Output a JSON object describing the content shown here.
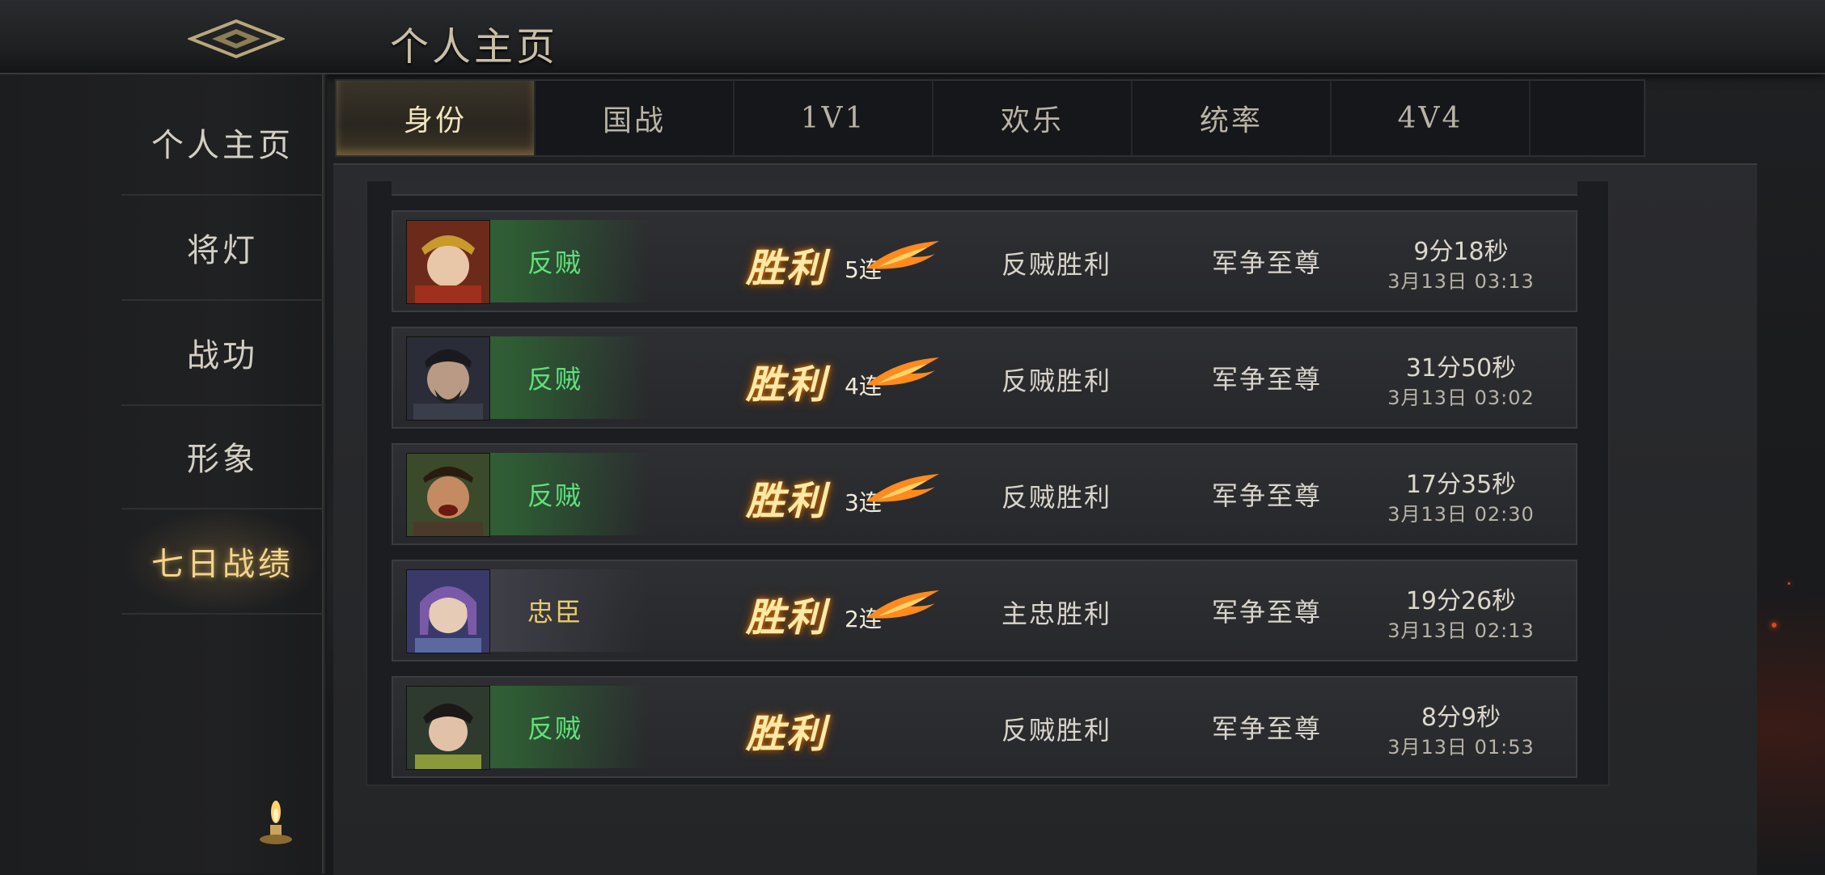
{
  "header": {
    "title": "个人主页",
    "back_icon": "ornate-diamond-back-icon"
  },
  "sidebar": {
    "items": [
      {
        "label": "个人主页",
        "active": false
      },
      {
        "label": "将灯",
        "active": false
      },
      {
        "label": "战功",
        "active": false
      },
      {
        "label": "形象",
        "active": false
      },
      {
        "label": "七日战绩",
        "active": true
      }
    ],
    "decor_icon": "candle-icon"
  },
  "tabs": [
    {
      "label": "身份",
      "active": true
    },
    {
      "label": "国战",
      "active": false
    },
    {
      "label": "1V1",
      "active": false
    },
    {
      "label": "欢乐",
      "active": false
    },
    {
      "label": "统率",
      "active": false
    },
    {
      "label": "4V4",
      "active": false
    }
  ],
  "records": [
    {
      "role": "反贼",
      "role_type": "rebel",
      "outcome": "胜利",
      "streak_num": "5",
      "streak_suffix": "连",
      "result": "反贼胜利",
      "mode": "军争至尊",
      "duration": "9分18秒",
      "datetime": "3月13日 03:13",
      "avatar_icon": "female-general-avatar-icon"
    },
    {
      "role": "反贼",
      "role_type": "rebel",
      "outcome": "胜利",
      "streak_num": "4",
      "streak_suffix": "连",
      "result": "反贼胜利",
      "mode": "军争至尊",
      "duration": "31分50秒",
      "datetime": "3月13日 03:02",
      "avatar_icon": "bearded-general-avatar-icon"
    },
    {
      "role": "反贼",
      "role_type": "rebel",
      "outcome": "胜利",
      "streak_num": "3",
      "streak_suffix": "连",
      "result": "反贼胜利",
      "mode": "军争至尊",
      "duration": "17分35秒",
      "datetime": "3月13日 02:30",
      "avatar_icon": "shouting-general-avatar-icon"
    },
    {
      "role": "忠臣",
      "role_type": "loyal",
      "outcome": "胜利",
      "streak_num": "2",
      "streak_suffix": "连",
      "result": "主忠胜利",
      "mode": "军争至尊",
      "duration": "19分26秒",
      "datetime": "3月13日 02:13",
      "avatar_icon": "purple-hair-general-avatar-icon"
    },
    {
      "role": "反贼",
      "role_type": "rebel",
      "outcome": "胜利",
      "streak_num": "",
      "streak_suffix": "",
      "result": "反贼胜利",
      "mode": "军争至尊",
      "duration": "8分9秒",
      "datetime": "3月13日 01:53",
      "avatar_icon": "young-general-avatar-icon"
    }
  ],
  "colors": {
    "accent_gold": "#f3d48c",
    "rebel_green": "#5fe07a",
    "loyal_gold": "#e8cc6a"
  }
}
